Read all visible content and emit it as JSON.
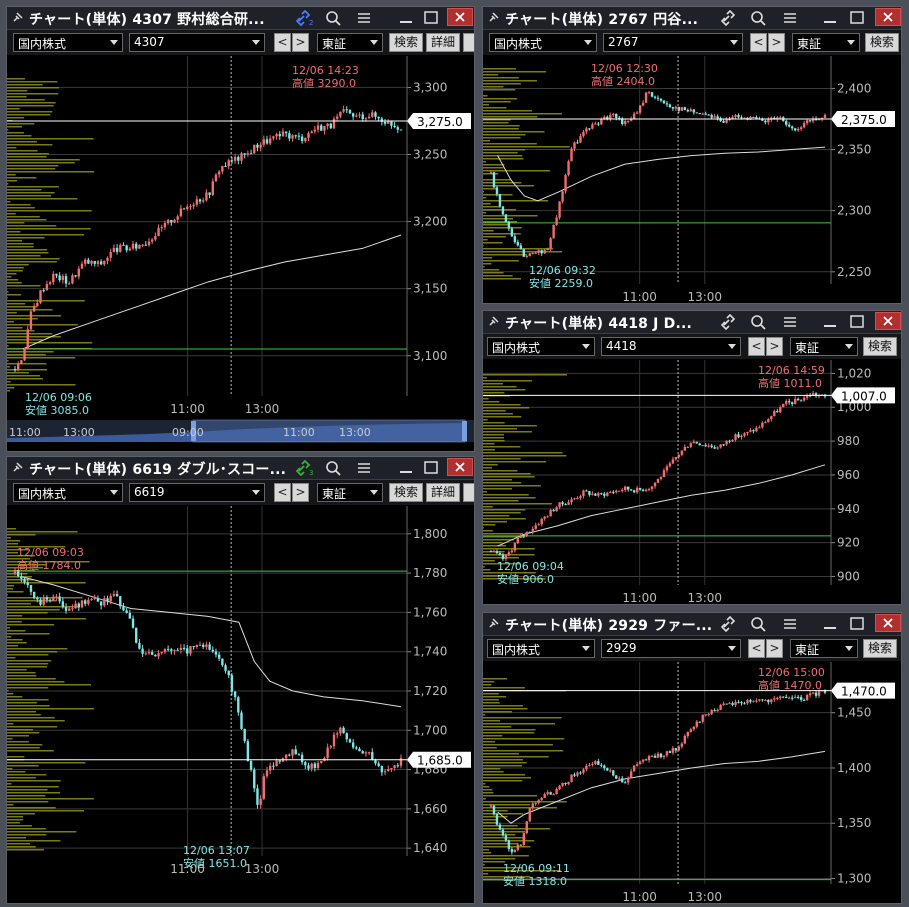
{
  "colors": {
    "accent_up": "#f26d6d",
    "accent_down": "#7fe6e6",
    "vwap": "#dddddd",
    "support": "#33cc44",
    "volume_profile": "#9a9a1a",
    "high_label": "#f26d6d",
    "low_label": "#7fe6e6"
  },
  "common": {
    "market": "国内株式",
    "exchange": "東証",
    "search": "検索",
    "detail": "詳細",
    "prev": "<",
    "next": ">"
  },
  "panels": [
    {
      "id": "p1",
      "title": "チャート(単体) 4307 野村総合研...",
      "code": "4307",
      "has_detail": true,
      "link_badge": "2",
      "link_color": "#4a7cff",
      "axis": {
        "ymin": 3070,
        "ymax": 3310,
        "ticks": [
          "3,300",
          "3,250",
          "3,200",
          "3,150",
          "3,100"
        ],
        "tick_vals": [
          3300,
          3250,
          3200,
          3150,
          3100
        ]
      },
      "last_price": "3,275.0",
      "last_val": 3275,
      "support_val": 3105,
      "high": {
        "time": "12/06 14:23",
        "label": "高値 3290.0"
      },
      "low": {
        "time": "12/06 09:06",
        "label": "安値 3085.0"
      },
      "xticks": [
        "11:00",
        "13:00"
      ],
      "nav_labels": [
        "11:00",
        "13:00",
        "09:00",
        "11:00",
        "13:00"
      ],
      "path": [
        [
          0,
          3090
        ],
        [
          0.02,
          3100
        ],
        [
          0.04,
          3130
        ],
        [
          0.07,
          3150
        ],
        [
          0.1,
          3160
        ],
        [
          0.14,
          3155
        ],
        [
          0.18,
          3170
        ],
        [
          0.22,
          3168
        ],
        [
          0.26,
          3180
        ],
        [
          0.3,
          3180
        ],
        [
          0.34,
          3185
        ],
        [
          0.38,
          3195
        ],
        [
          0.42,
          3205
        ],
        [
          0.46,
          3215
        ],
        [
          0.5,
          3220
        ],
        [
          0.53,
          3240
        ],
        [
          0.56,
          3245
        ],
        [
          0.6,
          3250
        ],
        [
          0.63,
          3258
        ],
        [
          0.67,
          3262
        ],
        [
          0.7,
          3265
        ],
        [
          0.74,
          3262
        ],
        [
          0.78,
          3270
        ],
        [
          0.82,
          3272
        ],
        [
          0.85,
          3282
        ],
        [
          0.88,
          3278
        ],
        [
          0.92,
          3280
        ],
        [
          0.96,
          3275
        ],
        [
          1.0,
          3270
        ]
      ],
      "vwap": [
        [
          0.02,
          3105
        ],
        [
          0.1,
          3115
        ],
        [
          0.2,
          3125
        ],
        [
          0.3,
          3135
        ],
        [
          0.4,
          3145
        ],
        [
          0.5,
          3155
        ],
        [
          0.6,
          3163
        ],
        [
          0.7,
          3170
        ],
        [
          0.8,
          3175
        ],
        [
          0.9,
          3180
        ],
        [
          1.0,
          3190
        ]
      ]
    },
    {
      "id": "p2",
      "title": "チャート(単体) 2767 円谷...",
      "code": "2767",
      "has_detail": false,
      "axis": {
        "ymin": 2240,
        "ymax": 2420,
        "ticks": [
          "2,400",
          "2,350",
          "2,300",
          "2,250"
        ],
        "tick_vals": [
          2400,
          2350,
          2300,
          2250
        ]
      },
      "last_price": "2,375.0",
      "last_val": 2375,
      "support_val": 2290,
      "high": {
        "time": "12/06 12:30",
        "label": "高値 2404.0"
      },
      "low": {
        "time": "12/06 09:32",
        "label": "安値 2259.0"
      },
      "xticks": [
        "11:00",
        "13:00"
      ],
      "path": [
        [
          0,
          2330
        ],
        [
          0.03,
          2300
        ],
        [
          0.06,
          2280
        ],
        [
          0.1,
          2262
        ],
        [
          0.14,
          2265
        ],
        [
          0.17,
          2270
        ],
        [
          0.2,
          2300
        ],
        [
          0.24,
          2350
        ],
        [
          0.28,
          2365
        ],
        [
          0.32,
          2372
        ],
        [
          0.36,
          2378
        ],
        [
          0.4,
          2372
        ],
        [
          0.44,
          2380
        ],
        [
          0.47,
          2398
        ],
        [
          0.5,
          2390
        ],
        [
          0.54,
          2385
        ],
        [
          0.58,
          2382
        ],
        [
          0.62,
          2380
        ],
        [
          0.66,
          2378
        ],
        [
          0.7,
          2372
        ],
        [
          0.74,
          2378
        ],
        [
          0.78,
          2375
        ],
        [
          0.82,
          2372
        ],
        [
          0.86,
          2376
        ],
        [
          0.9,
          2365
        ],
        [
          0.94,
          2372
        ],
        [
          1.0,
          2378
        ]
      ],
      "vwap": [
        [
          0.02,
          2345
        ],
        [
          0.06,
          2325
        ],
        [
          0.1,
          2312
        ],
        [
          0.14,
          2308
        ],
        [
          0.2,
          2315
        ],
        [
          0.3,
          2328
        ],
        [
          0.4,
          2338
        ],
        [
          0.5,
          2342
        ],
        [
          0.6,
          2345
        ],
        [
          0.7,
          2347
        ],
        [
          0.8,
          2348
        ],
        [
          0.9,
          2350
        ],
        [
          1.0,
          2352
        ]
      ]
    },
    {
      "id": "p3",
      "title": "チャート(単体) 4418 J D...",
      "code": "4418",
      "has_detail": false,
      "axis": {
        "ymin": 895,
        "ymax": 1022,
        "ticks": [
          "1,020",
          "1,000",
          "980",
          "960",
          "940",
          "920",
          "900"
        ],
        "tick_vals": [
          1020,
          1000,
          980,
          960,
          940,
          920,
          900
        ]
      },
      "last_price": "1,007.0",
      "last_val": 1007,
      "support_val": 924,
      "high": {
        "time": "12/06 14:59",
        "label": "高値 1011.0"
      },
      "low": {
        "time": "12/06 09:04",
        "label": "安値 906.0"
      },
      "xticks": [
        "11:00",
        "13:00"
      ],
      "path": [
        [
          0,
          915
        ],
        [
          0.04,
          910
        ],
        [
          0.08,
          922
        ],
        [
          0.12,
          928
        ],
        [
          0.16,
          935
        ],
        [
          0.2,
          942
        ],
        [
          0.24,
          945
        ],
        [
          0.28,
          950
        ],
        [
          0.32,
          948
        ],
        [
          0.36,
          950
        ],
        [
          0.4,
          952
        ],
        [
          0.44,
          951
        ],
        [
          0.48,
          953
        ],
        [
          0.52,
          962
        ],
        [
          0.56,
          972
        ],
        [
          0.6,
          980
        ],
        [
          0.64,
          978
        ],
        [
          0.68,
          976
        ],
        [
          0.72,
          982
        ],
        [
          0.76,
          984
        ],
        [
          0.8,
          988
        ],
        [
          0.84,
          995
        ],
        [
          0.88,
          1002
        ],
        [
          0.92,
          1004
        ],
        [
          0.96,
          1008
        ],
        [
          1.0,
          1006
        ]
      ],
      "vwap": [
        [
          0.02,
          918
        ],
        [
          0.1,
          925
        ],
        [
          0.2,
          930
        ],
        [
          0.3,
          936
        ],
        [
          0.4,
          940
        ],
        [
          0.5,
          944
        ],
        [
          0.6,
          948
        ],
        [
          0.7,
          951
        ],
        [
          0.8,
          955
        ],
        [
          0.9,
          960
        ],
        [
          1.0,
          966
        ]
      ]
    },
    {
      "id": "p4",
      "title": "チャート(単体) 6619 ダブル･スコー...",
      "code": "6619",
      "has_detail": true,
      "link_badge": "3",
      "link_color": "#3ab03a",
      "axis": {
        "ymin": 1636,
        "ymax": 1805,
        "ticks": [
          "1,800",
          "1,780",
          "1,760",
          "1,740",
          "1,720",
          "1,700",
          "1,680",
          "1,660",
          "1,640"
        ],
        "tick_vals": [
          1800,
          1780,
          1760,
          1740,
          1720,
          1700,
          1680,
          1660,
          1640
        ]
      },
      "last_price": "1,685.0",
      "last_val": 1685,
      "support_val": 1781,
      "high": {
        "time": "12/06 09:03",
        "label": "高値 1784.0"
      },
      "low": {
        "time": "12/06 13:07",
        "label": "安値 1651.0"
      },
      "xticks": [
        "11:00",
        "13:00"
      ],
      "path": [
        [
          0,
          1780
        ],
        [
          0.03,
          1775
        ],
        [
          0.06,
          1765
        ],
        [
          0.1,
          1768
        ],
        [
          0.14,
          1760
        ],
        [
          0.18,
          1766
        ],
        [
          0.22,
          1765
        ],
        [
          0.26,
          1768
        ],
        [
          0.3,
          1755
        ],
        [
          0.32,
          1742
        ],
        [
          0.36,
          1738
        ],
        [
          0.4,
          1742
        ],
        [
          0.44,
          1740
        ],
        [
          0.48,
          1745
        ],
        [
          0.52,
          1740
        ],
        [
          0.55,
          1730
        ],
        [
          0.58,
          1708
        ],
        [
          0.61,
          1680
        ],
        [
          0.63,
          1660
        ],
        [
          0.65,
          1680
        ],
        [
          0.68,
          1685
        ],
        [
          0.72,
          1690
        ],
        [
          0.76,
          1680
        ],
        [
          0.8,
          1685
        ],
        [
          0.84,
          1702
        ],
        [
          0.88,
          1690
        ],
        [
          0.92,
          1688
        ],
        [
          0.96,
          1678
        ],
        [
          1.0,
          1685
        ]
      ],
      "vwap": [
        [
          0.02,
          1778
        ],
        [
          0.1,
          1774
        ],
        [
          0.2,
          1768
        ],
        [
          0.3,
          1762
        ],
        [
          0.4,
          1760
        ],
        [
          0.5,
          1758
        ],
        [
          0.58,
          1755
        ],
        [
          0.62,
          1735
        ],
        [
          0.66,
          1725
        ],
        [
          0.72,
          1720
        ],
        [
          0.8,
          1717
        ],
        [
          0.9,
          1715
        ],
        [
          1.0,
          1712
        ]
      ]
    },
    {
      "id": "p5",
      "title": "チャート(単体) 2929 ファー...",
      "code": "2929",
      "has_detail": false,
      "axis": {
        "ymin": 1295,
        "ymax": 1485,
        "ticks": [
          "1,450",
          "1,400",
          "1,350",
          "1,300"
        ],
        "tick_vals": [
          1450,
          1400,
          1350,
          1300
        ]
      },
      "last_price": "1,470.0",
      "last_val": 1470,
      "support_val": 1299,
      "high": {
        "time": "12/06 15:00",
        "label": "高値 1470.0"
      },
      "low": {
        "time": "12/06 09:11",
        "label": "安値 1318.0"
      },
      "xticks": [
        "11:00",
        "13:00"
      ],
      "path": [
        [
          0,
          1365
        ],
        [
          0.03,
          1340
        ],
        [
          0.06,
          1325
        ],
        [
          0.09,
          1330
        ],
        [
          0.12,
          1368
        ],
        [
          0.16,
          1375
        ],
        [
          0.2,
          1380
        ],
        [
          0.24,
          1392
        ],
        [
          0.28,
          1400
        ],
        [
          0.32,
          1405
        ],
        [
          0.36,
          1395
        ],
        [
          0.4,
          1388
        ],
        [
          0.44,
          1405
        ],
        [
          0.48,
          1410
        ],
        [
          0.52,
          1412
        ],
        [
          0.56,
          1418
        ],
        [
          0.6,
          1435
        ],
        [
          0.64,
          1448
        ],
        [
          0.68,
          1455
        ],
        [
          0.72,
          1458
        ],
        [
          0.76,
          1460
        ],
        [
          0.8,
          1462
        ],
        [
          0.84,
          1460
        ],
        [
          0.88,
          1465
        ],
        [
          0.92,
          1462
        ],
        [
          0.96,
          1466
        ],
        [
          1.0,
          1470
        ]
      ],
      "vwap": [
        [
          0.02,
          1360
        ],
        [
          0.06,
          1350
        ],
        [
          0.1,
          1358
        ],
        [
          0.2,
          1370
        ],
        [
          0.3,
          1382
        ],
        [
          0.4,
          1390
        ],
        [
          0.5,
          1395
        ],
        [
          0.6,
          1400
        ],
        [
          0.7,
          1404
        ],
        [
          0.8,
          1406
        ],
        [
          0.9,
          1410
        ],
        [
          1.0,
          1415
        ]
      ]
    }
  ]
}
